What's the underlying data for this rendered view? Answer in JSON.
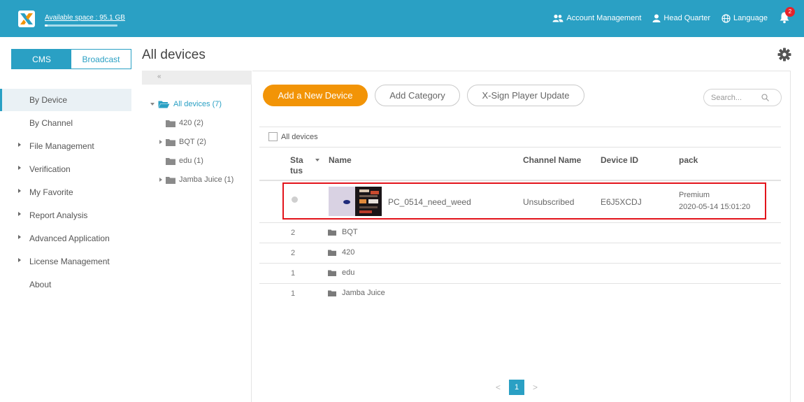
{
  "topbar": {
    "available_space": "Available space : 95.1 GB",
    "space_used_fraction": 0.04,
    "account_management": "Account Management",
    "head_quarter": "Head Quarter",
    "language": "Language",
    "notification_count": "2",
    "bg_color": "#2aa0c4"
  },
  "sidebar": {
    "tabs": [
      {
        "label": "CMS",
        "active": true
      },
      {
        "label": "Broadcast",
        "active": false
      }
    ],
    "items": [
      {
        "label": "By Device",
        "active": true,
        "expandable": false
      },
      {
        "label": "By Channel",
        "active": false,
        "expandable": false
      },
      {
        "label": "File Management",
        "active": false,
        "expandable": true
      },
      {
        "label": "Verification",
        "active": false,
        "expandable": true
      },
      {
        "label": "My Favorite",
        "active": false,
        "expandable": true
      },
      {
        "label": "Report Analysis",
        "active": false,
        "expandable": true
      },
      {
        "label": "Advanced Application",
        "active": false,
        "expandable": true
      },
      {
        "label": "License Management",
        "active": false,
        "expandable": true
      },
      {
        "label": "About",
        "active": false,
        "expandable": false
      }
    ]
  },
  "page": {
    "title": "All devices"
  },
  "tree": {
    "collapse": "«",
    "root": "All devices (7)",
    "children": [
      {
        "label": "420 (2)",
        "expandable": false
      },
      {
        "label": "BQT (2)",
        "expandable": true
      },
      {
        "label": "edu (1)",
        "expandable": false
      },
      {
        "label": "Jamba Juice (1)",
        "expandable": true
      }
    ]
  },
  "toolbar": {
    "add_device": "Add a New Device",
    "add_category": "Add Category",
    "player_update": "X-Sign Player Update",
    "search_placeholder": "Search...",
    "accent_color": "#f29407"
  },
  "table": {
    "select_all_label": "All devices",
    "headers": {
      "status": "Status",
      "name": "Name",
      "channel": "Channel Name",
      "device_id": "Device ID",
      "pack": "pack"
    },
    "device": {
      "name": "PC_0514_need_weed",
      "channel": "Unsubscribed",
      "device_id": "E6J5XCDJ",
      "pack_type": "Premium",
      "pack_date": "2020-05-14 15:01:20"
    },
    "folders": [
      {
        "count": "2",
        "name": "BQT"
      },
      {
        "count": "2",
        "name": "420"
      },
      {
        "count": "1",
        "name": "edu"
      },
      {
        "count": "1",
        "name": "Jamba Juice"
      }
    ]
  },
  "pagination": {
    "prev": "<",
    "current": "1",
    "next": ">"
  }
}
